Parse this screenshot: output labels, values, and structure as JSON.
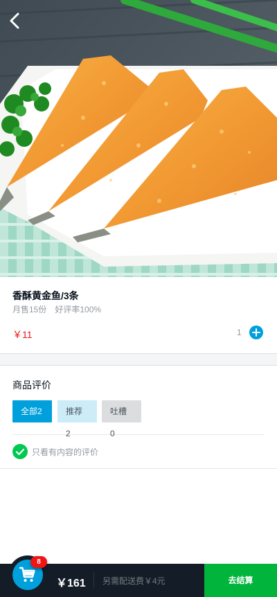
{
  "product": {
    "name": "香酥黄金鱼/3条",
    "sell_count": "月售15份",
    "rating": "好评率100%",
    "price": "￥11",
    "cart_count": "1"
  },
  "ratings": {
    "title": "商品评价",
    "filters": [
      {
        "label": "全部",
        "count": "2",
        "active": true
      },
      {
        "label": "推荐",
        "count": "2",
        "active": false
      },
      {
        "label": "吐槽",
        "count": "0",
        "active": false
      }
    ],
    "only_content_label": "只看有内容的评价"
  },
  "cart": {
    "badge": "8",
    "total": "￥161",
    "delivery": "另需配送费￥4元",
    "pay_label": "去结算"
  },
  "icons": {
    "back": "chevron-left-icon",
    "add": "plus-circle-icon",
    "check": "check-circle-icon",
    "cart": "shopping-cart-icon"
  },
  "colors": {
    "accent": "#00a0dc",
    "price": "#f01414",
    "pay": "#00b43c",
    "check": "#00c850",
    "bar": "#141d27"
  }
}
